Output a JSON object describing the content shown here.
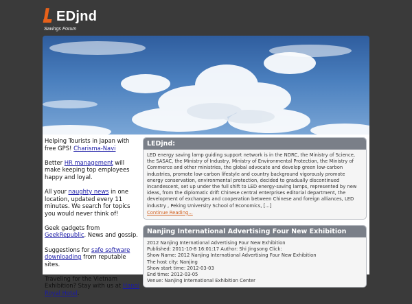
{
  "site": {
    "name": "EDjnd",
    "tagline": "Savings Forum",
    "logo_letter": "L",
    "accent_color": "#e8611a"
  },
  "sidebar": {
    "blocks": [
      {
        "before": "Helping Tourists in Japan with free GPS!  ",
        "link": "Charisma-Navi",
        "after": ""
      },
      {
        "before": "Better ",
        "link": "HR management",
        "after": " will make keeping top employees happy and loyal."
      },
      {
        "before": "All your ",
        "link": "naughty news",
        "after": " in one location, updated every 11 minutes.  We search for topics you would never think of!"
      },
      {
        "before": "Geek gadgets from ",
        "link": "GeekRepublic",
        "after": ".  News and gossip."
      },
      {
        "before": "Suggestions for ",
        "link": "safe software downloading",
        "after": " from reputable sites."
      },
      {
        "before": "Traveling for the Vietnam Exhibition?  Stay with us at ",
        "link": "Hanoi Royal Hotel",
        "after": "."
      }
    ]
  },
  "about": {
    "title": "LEDjnd:",
    "body": "LED energy saving lamp guiding support network is in the NDRC, the Ministry of Science, the SASAC, the Ministry of Industry, Ministry of Environmental Protection, the Ministry of Commerce and other ministries, the global advocate and develop green low-carbon industries, promote low-carbon lifestyle and country background vigorously promote energy conservation, environmental protection, decided to gradually discontinued incandescent, set up under the full shift to LED energy-saving lamps, represented by new ideas, from the diplomatic drift Chinese central enterprises editorial department, the development of exchanges and cooperation between Chinese and foreign alliances, LED industry , Peking University School of Economics, [...]",
    "more_label": "Continue Reading..."
  },
  "post": {
    "title": "Nanjing International Advertising Four New Exhibition",
    "lines": [
      "2012 Nanjing International Advertising Four New Exhibition",
      "Published: 2011-10-8 16:01:17 Author: Shi Jingsong Click:",
      "Show Name:     2012 Nanjing International Advertising Four New Exhibition",
      "The host city:      Nanjing",
      "Show start time:       2012-03-03",
      "End time:       2012-03-05",
      "Venue:      Nanjing International Exhibition Center"
    ]
  },
  "colors": {
    "page_background": "#3a3a3a",
    "panel_title_bar": "#7a7f88",
    "sidebar_link": "#1a1aa6",
    "more_link": "#d2601e"
  }
}
